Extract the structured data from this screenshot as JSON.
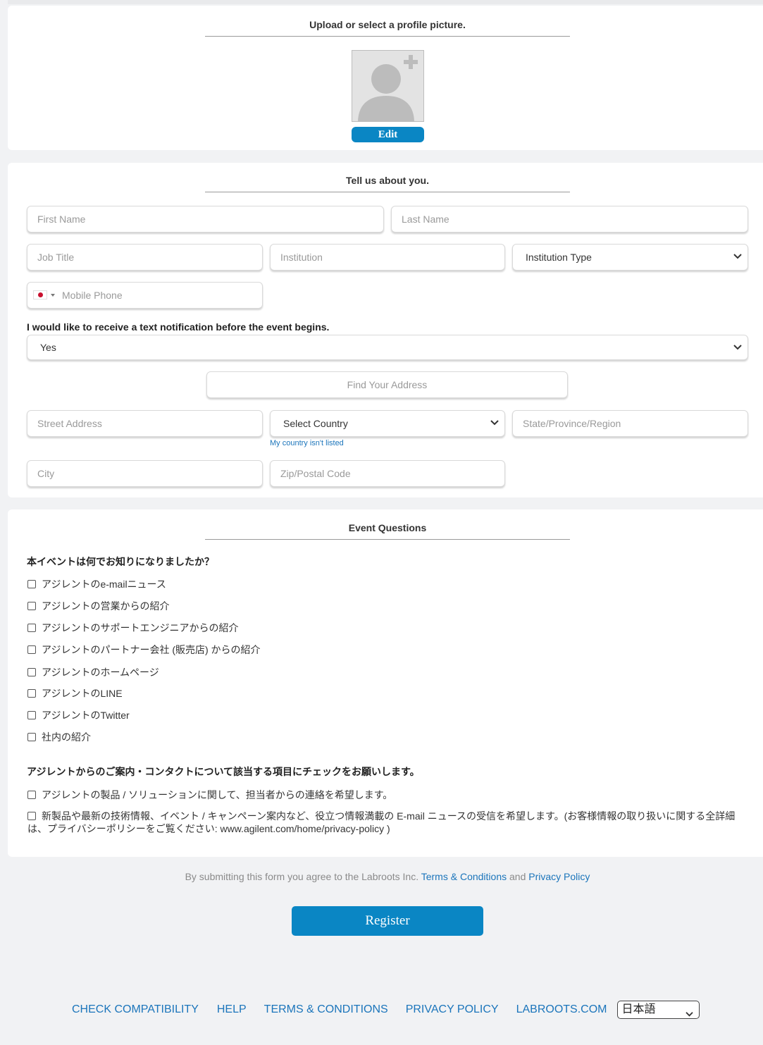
{
  "profile": {
    "title": "Upload or select a profile picture.",
    "edit_label": "Edit"
  },
  "about": {
    "title": "Tell us about you.",
    "first_name_placeholder": "First Name",
    "last_name_placeholder": "Last Name",
    "job_title_placeholder": "Job Title",
    "institution_placeholder": "Institution",
    "institution_type_value": "Institution Type",
    "mobile_phone_placeholder": "Mobile Phone",
    "text_notification_label": "I would like to receive a text notification before the event begins.",
    "text_notification_value": "Yes",
    "find_address_placeholder": "Find Your Address",
    "street_placeholder": "Street Address",
    "country_value": "Select Country",
    "country_not_listed": "My country isn't listed",
    "state_placeholder": "State/Province/Region",
    "city_placeholder": "City",
    "zip_placeholder": "Zip/Postal Code"
  },
  "event": {
    "title": "Event Questions",
    "question1": "本イベントは何でお知りになりましたか？",
    "options1": [
      "アジレントのe-mailニュース",
      "アジレントの営業からの紹介",
      "アジレントのサポートエンジニアからの紹介",
      "アジレントのパートナー会社 (販売店) からの紹介",
      "アジレントのホームページ",
      "アジレントのLINE",
      "アジレントのTwitter",
      "社内の紹介"
    ],
    "question2": "アジレントからのご案内・コンタクトについて該当する項目にチェックをお願いします。",
    "options2": [
      "アジレントの製品 / ソリューションに関して、担当者からの連絡を希望します。",
      "新製品や最新の技術情報、イベント / キャンペーン案内など、役立つ情報満載の E-mail ニュースの受信を希望します。(お客様情報の取り扱いに関する全詳細は、プライバシーポリシーをご覧ください: www.agilent.com/home/privacy-policy )"
    ]
  },
  "agreement": {
    "prefix": "By submitting this form you agree to the Labroots Inc.",
    "terms_link": "Terms & Conditions",
    "and": "and",
    "privacy_link": "Privacy Policy"
  },
  "register_label": "Register",
  "footer": {
    "links": [
      "CHECK COMPATIBILITY",
      "HELP",
      "TERMS & CONDITIONS",
      "PRIVACY POLICY",
      "LABROOTS.COM"
    ],
    "language_value": "日本語"
  },
  "colors": {
    "accent": "#0a86c4",
    "link": "#1b75bb",
    "page_bg": "#f1f2f4"
  }
}
